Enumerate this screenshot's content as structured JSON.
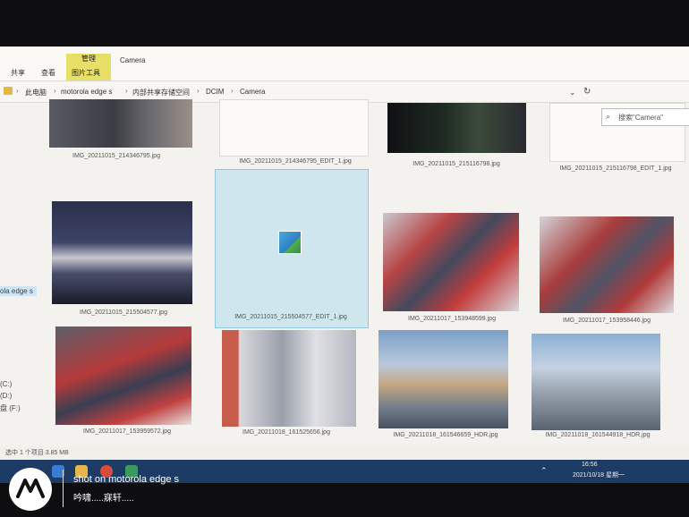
{
  "ribbon": {
    "tabs": [
      "共享",
      "查看"
    ],
    "manage_label": "管理",
    "camera_label": "Camera",
    "tool_label": "图片工具"
  },
  "address": {
    "crumbs": [
      "此电脑",
      "motorola edge s",
      "内部共享存储空间",
      "DCIM",
      "Camera"
    ],
    "search_placeholder": "搜索\"Camera\""
  },
  "nav_stubs": {
    "device": "ola edge s",
    "drive_c": "(C:)",
    "drive_d": "(D:)",
    "drive_f": "盘 (F:)"
  },
  "files": [
    {
      "name": "IMG_20211015_214346795.jpg"
    },
    {
      "name": "IMG_20211015_214346795_EDIT_1.jpg"
    },
    {
      "name": "IMG_20211015_215116798.jpg"
    },
    {
      "name": "IMG_20211015_215116798_EDIT_1.jpg"
    },
    {
      "name": "IMG_20211015_215504577.jpg"
    },
    {
      "name": "IMG_20211015_215504577_EDIT_1.jpg"
    },
    {
      "name": "IMG_20211017_153948599.jpg"
    },
    {
      "name": "IMG_20211017_153958446.jpg"
    },
    {
      "name": "IMG_20211017_153959572.jpg"
    },
    {
      "name": "IMG_20211018_161525656.jpg"
    },
    {
      "name": "IMG_20211018_161546659_HDR.jpg"
    },
    {
      "name": "IMG_20211018_161544918_HDR.jpg"
    }
  ],
  "status": {
    "selected": "选中 1 个项目  3.85 MB"
  },
  "clock": {
    "time": "16:56",
    "date": "2021/10/18 星期一"
  },
  "watermark": {
    "line1": "shot on motorola edge s",
    "line2": "吟啸.....寐轩....."
  }
}
